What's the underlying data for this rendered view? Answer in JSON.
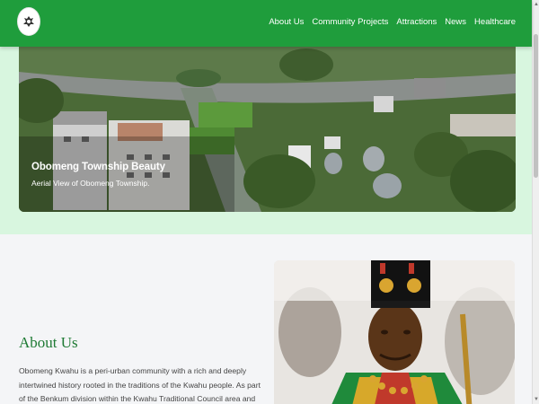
{
  "nav": {
    "logo_name": "obomeng-crest-logo",
    "links": [
      {
        "label": "About Us"
      },
      {
        "label": "Community Projects"
      },
      {
        "label": "Attractions"
      },
      {
        "label": "News"
      },
      {
        "label": "Healthcare"
      }
    ]
  },
  "hero": {
    "title": "Obomeng Township Beauty",
    "subtitle": "Aerial View of Obomeng Township."
  },
  "about": {
    "title": "About Us",
    "text": "Obomeng Kwahu is a peri-urban community with a rich and deeply intertwined history rooted in the traditions of the Kwahu people. As part of the Benkum division within the Kwahu Traditional Council area and a proud member of the Aduana clan"
  },
  "colors": {
    "brand_green": "#1f9d3c",
    "hero_band": "#d8f6df",
    "heading_green": "#1e7a34"
  }
}
